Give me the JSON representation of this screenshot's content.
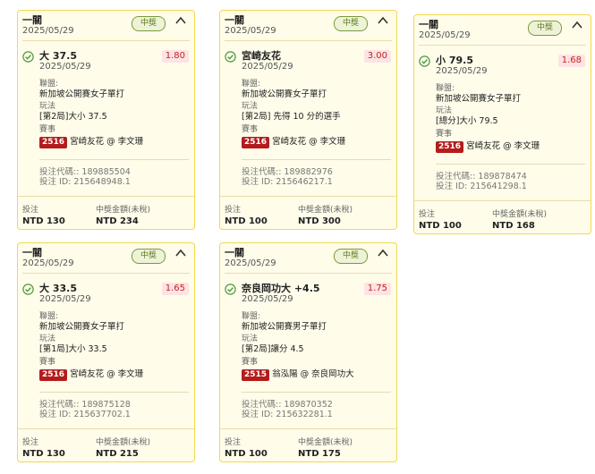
{
  "cards": [
    {
      "title": "一關",
      "date": "2025/05/29",
      "badge": "中獎",
      "selection": "大 37.5",
      "sel_date": "2025/05/29",
      "odds": "1.80",
      "league_label": "聯盟:",
      "league": "新加坡公開賽女子單打",
      "play_label": "玩法",
      "play": "[第2局]大小 37.5",
      "event_label": "賽事",
      "event_code": "2516",
      "event": "宮崎友花 @ 李文珊",
      "bet_code": "投注代碼:: 189885504",
      "bet_id": "投注 ID: 215648948.1",
      "stake_label": "投注",
      "stake": "NTD 130",
      "win_label": "中獎金額(未稅)",
      "win": "NTD 234"
    },
    {
      "title": "一關",
      "date": "2025/05/29",
      "badge": "中獎",
      "selection": "宮崎友花",
      "sel_date": "2025/05/29",
      "odds": "3.00",
      "league_label": "聯盟:",
      "league": "新加坡公開賽女子單打",
      "play_label": "玩法",
      "play": "[第2局] 先得 10 分的選手",
      "event_label": "賽事",
      "event_code": "2516",
      "event": "宮崎友花 @ 李文珊",
      "bet_code": "投注代碼:: 189882976",
      "bet_id": "投注 ID: 215646217.1",
      "stake_label": "投注",
      "stake": "NTD 100",
      "win_label": "中獎金額(未稅)",
      "win": "NTD 300"
    },
    {
      "title": "一關",
      "date": "2025/05/29",
      "badge": "中獎",
      "selection": "小 79.5",
      "sel_date": "2025/05/29",
      "odds": "1.68",
      "league_label": "聯盟:",
      "league": "新加坡公開賽女子單打",
      "play_label": "玩法",
      "play": "[總分]大小 79.5",
      "event_label": "賽事",
      "event_code": "2516",
      "event": "宮崎友花 @ 李文珊",
      "bet_code": "投注代碼:: 189878474",
      "bet_id": "投注 ID: 215641298.1",
      "stake_label": "投注",
      "stake": "NTD 100",
      "win_label": "中獎金額(未稅)",
      "win": "NTD 168"
    },
    {
      "title": "一關",
      "date": "2025/05/29",
      "badge": "中獎",
      "selection": "大 33.5",
      "sel_date": "2025/05/29",
      "odds": "1.65",
      "league_label": "聯盟:",
      "league": "新加坡公開賽女子單打",
      "play_label": "玩法",
      "play": "[第1局]大小 33.5",
      "event_label": "賽事",
      "event_code": "2516",
      "event": "宮崎友花 @ 李文珊",
      "bet_code": "投注代碼:: 189875128",
      "bet_id": "投注 ID: 215637702.1",
      "stake_label": "投注",
      "stake": "NTD 130",
      "win_label": "中獎金額(未稅)",
      "win": "NTD 215"
    },
    {
      "title": "一關",
      "date": "2025/05/29",
      "badge": "中獎",
      "selection": "奈良岡功大 +4.5",
      "sel_date": "2025/05/29",
      "odds": "1.75",
      "league_label": "聯盟:",
      "league": "新加坡公開賽男子單打",
      "play_label": "玩法",
      "play": "[第2局]讓分 4.5",
      "event_label": "賽事",
      "event_code": "2515",
      "event": "翁泓陽 @ 奈良岡功大",
      "bet_code": "投注代碼:: 189870352",
      "bet_id": "投注 ID: 215632281.1",
      "stake_label": "投注",
      "stake": "NTD 100",
      "win_label": "中獎金額(未稅)",
      "win": "NTD 175"
    }
  ],
  "colors": {
    "border": "#f2d94e",
    "card_bg": "#fffcea",
    "badge_green": "#5b7a20",
    "odds_red": "#c42222",
    "event_code_bg": "#b41c1c",
    "check_green": "#4a9a3a"
  },
  "icons": {
    "check": "check-circle-icon",
    "collapse": "chevron-up-icon"
  }
}
